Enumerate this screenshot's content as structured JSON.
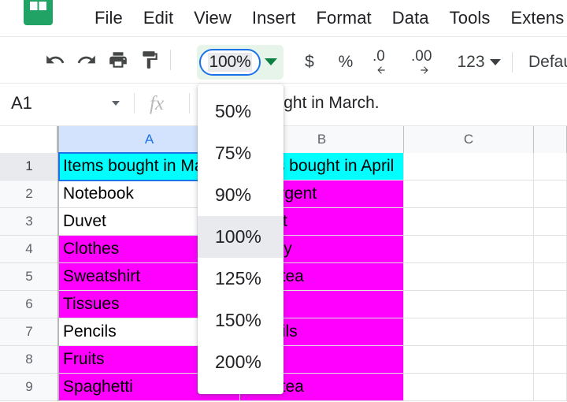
{
  "app": {
    "name": "Google Sheets",
    "logo_icon": "sheets-logo-icon"
  },
  "menubar": {
    "items": [
      {
        "label": "File",
        "name": "menu-file"
      },
      {
        "label": "Edit",
        "name": "menu-edit"
      },
      {
        "label": "View",
        "name": "menu-view"
      },
      {
        "label": "Insert",
        "name": "menu-insert"
      },
      {
        "label": "Format",
        "name": "menu-format"
      },
      {
        "label": "Data",
        "name": "menu-data"
      },
      {
        "label": "Tools",
        "name": "menu-tools"
      },
      {
        "label": "Extens",
        "name": "menu-extensions"
      }
    ]
  },
  "toolbar": {
    "undo_icon": "undo-icon",
    "redo_icon": "redo-icon",
    "print_icon": "print-icon",
    "paint_format_icon": "paint-format-icon",
    "zoom_value": "100%",
    "zoom_caret_icon": "chevron-down-icon",
    "currency_label": "$",
    "percent_label": "%",
    "decrease_decimal_label": ".0",
    "increase_decimal_label": ".00",
    "number_format_label": "123",
    "number_format_caret_icon": "chevron-down-icon",
    "font_label": "Default"
  },
  "formulabar": {
    "name_box_value": "A1",
    "name_box_caret_icon": "chevron-down-icon",
    "fx_label": "fx",
    "formula_value": "Items bought in March."
  },
  "grid": {
    "columns": [
      {
        "label": "A",
        "name": "column-header-a",
        "selected": true
      },
      {
        "label": "B",
        "name": "column-header-b",
        "selected": false
      },
      {
        "label": "C",
        "name": "column-header-c",
        "selected": false
      },
      {
        "label": "",
        "name": "column-header-d",
        "selected": false
      }
    ],
    "rows": [
      {
        "number": "1",
        "selected": true,
        "cells": [
          {
            "value": "Items bought in March.",
            "fill": "#00ffff",
            "selected": true
          },
          {
            "value": "Items bought in April",
            "fill": "#00ffff",
            "selected": false
          },
          {
            "value": "",
            "fill": "#ffffff",
            "selected": false
          },
          {
            "value": "",
            "fill": "#ffffff",
            "selected": false
          }
        ]
      },
      {
        "number": "2",
        "selected": false,
        "cells": [
          {
            "value": "Notebook",
            "fill": "#ffffff",
            "selected": false
          },
          {
            "value": "Detergent",
            "fill": "#ff00ff",
            "selected": false
          },
          {
            "value": "",
            "fill": "#ffffff",
            "selected": false
          },
          {
            "value": "",
            "fill": "#ffffff",
            "selected": false
          }
        ]
      },
      {
        "number": "3",
        "selected": false,
        "cells": [
          {
            "value": "Duvet",
            "fill": "#ffffff",
            "selected": false
          },
          {
            "value": "Duvet",
            "fill": "#ff00ff",
            "selected": false
          },
          {
            "value": "",
            "fill": "#ffffff",
            "selected": false
          },
          {
            "value": "",
            "fill": "#ffffff",
            "selected": false
          }
        ]
      },
      {
        "number": "4",
        "selected": false,
        "cells": [
          {
            "value": "Clothes",
            "fill": "#ff00ff",
            "selected": false
          },
          {
            "value": "Honey",
            "fill": "#ff00ff",
            "selected": false
          },
          {
            "value": "",
            "fill": "#ffffff",
            "selected": false
          },
          {
            "value": "",
            "fill": "#ffffff",
            "selected": false
          }
        ]
      },
      {
        "number": "5",
        "selected": false,
        "cells": [
          {
            "value": "Sweatshirt",
            "fill": "#ff00ff",
            "selected": false
          },
          {
            "value": "Slim tea",
            "fill": "#ff00ff",
            "selected": false
          },
          {
            "value": "",
            "fill": "#ffffff",
            "selected": false
          },
          {
            "value": "",
            "fill": "#ffffff",
            "selected": false
          }
        ]
      },
      {
        "number": "6",
        "selected": false,
        "cells": [
          {
            "value": "Tissues",
            "fill": "#ff00ff",
            "selected": false
          },
          {
            "value": "",
            "fill": "#ff00ff",
            "selected": false
          },
          {
            "value": "",
            "fill": "#ffffff",
            "selected": false
          },
          {
            "value": "",
            "fill": "#ffffff",
            "selected": false
          }
        ]
      },
      {
        "number": "7",
        "selected": false,
        "cells": [
          {
            "value": "Pencils",
            "fill": "#ffffff",
            "selected": false
          },
          {
            "value": "Pencils",
            "fill": "#ff00ff",
            "selected": false
          },
          {
            "value": "",
            "fill": "#ffffff",
            "selected": false
          },
          {
            "value": "",
            "fill": "#ffffff",
            "selected": false
          }
        ]
      },
      {
        "number": "8",
        "selected": false,
        "cells": [
          {
            "value": "Fruits",
            "fill": "#ff00ff",
            "selected": false
          },
          {
            "value": "",
            "fill": "#ff00ff",
            "selected": false
          },
          {
            "value": "",
            "fill": "#ffffff",
            "selected": false
          },
          {
            "value": "",
            "fill": "#ffffff",
            "selected": false
          }
        ]
      },
      {
        "number": "9",
        "selected": false,
        "cells": [
          {
            "value": "Spaghetti",
            "fill": "#ff00ff",
            "selected": false
          },
          {
            "value": "Slim tea",
            "fill": "#ff00ff",
            "selected": false
          },
          {
            "value": "",
            "fill": "#ffffff",
            "selected": false
          },
          {
            "value": "",
            "fill": "#ffffff",
            "selected": false
          }
        ]
      }
    ]
  },
  "zoom_menu": {
    "options": [
      {
        "label": "50%",
        "active": false
      },
      {
        "label": "75%",
        "active": false
      },
      {
        "label": "90%",
        "active": false
      },
      {
        "label": "100%",
        "active": true
      },
      {
        "label": "125%",
        "active": false
      },
      {
        "label": "150%",
        "active": false
      },
      {
        "label": "200%",
        "active": false
      }
    ]
  },
  "colors": {
    "brand_green": "#21a366",
    "focus_blue": "#1a73e8",
    "cyan_fill": "#00ffff",
    "magenta_fill": "#ff00ff",
    "menu_highlight": "#e8eaed"
  }
}
